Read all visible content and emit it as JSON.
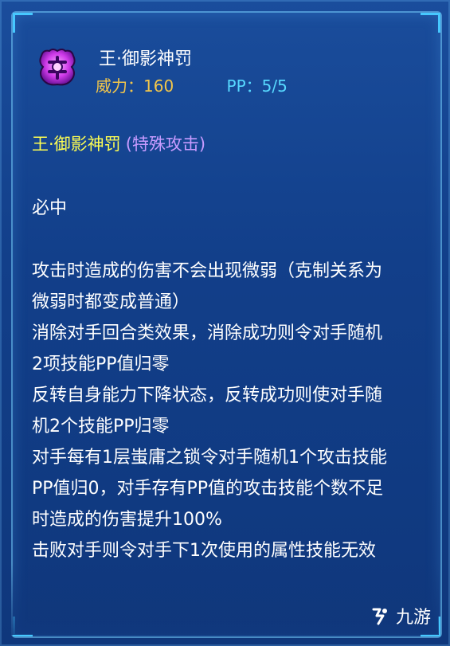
{
  "skill": {
    "name": "王·御影神罚",
    "power_label": "威力：",
    "power_value": "160",
    "pp_label": "PP：",
    "pp_value": "5/5"
  },
  "description": {
    "name": "王·御影神罚",
    "category": "(特殊攻击)",
    "lines": [
      "必中",
      "攻击时造成的伤害不会出现微弱（克制关系为",
      "微弱时都变成普通）",
      "消除对手回合类效果，消除成功则令对手随机",
      "2项技能PP值归零",
      "反转自身能力下降状态，反转成功则使对手随",
      "机2个技能PP归零",
      "对手每有1层蚩庸之锁令对手随机1个攻击技能",
      "PP值归0，对手存有PP值的攻击技能个数不足",
      "时造成的伤害提升100%",
      "击败对手则令对手下1次使用的属性技能无效"
    ]
  },
  "watermark": {
    "text": "九游"
  },
  "colors": {
    "power": "#f3c64a",
    "pp": "#57d8ff",
    "skill_name": "#ffff52",
    "category": "#c79bff"
  },
  "icons": {
    "skill": "purple-crest-icon",
    "logo": "jiuyou-logo-icon"
  }
}
